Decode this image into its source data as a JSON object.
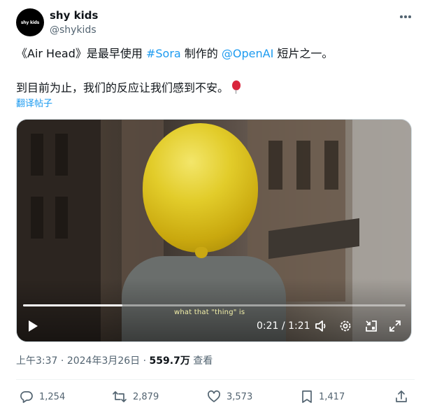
{
  "author": {
    "avatar_text": "shy kids",
    "display_name": "shy kids",
    "handle": "@shykids"
  },
  "tweet": {
    "line1_prefix": "《Air Head》是最早使用 ",
    "hashtag": "#Sora",
    "line1_mid": " 制作的 ",
    "mention": "@OpenAI",
    "line1_suffix": " 短片之一。",
    "line2": "到目前为止，我们的反应让我们感到不安。",
    "emoji": "balloon",
    "translate_label": "翻译帖子"
  },
  "video": {
    "subtitle": "what that \"thing\" is",
    "current_time": "0:21",
    "separator": " / ",
    "duration": "1:21",
    "progress_fraction": 0.26,
    "controls": [
      "play-icon",
      "volume-icon",
      "settings-icon",
      "picture-in-picture-icon",
      "fullscreen-icon"
    ]
  },
  "meta": {
    "time": "上午3:37",
    "dot": " · ",
    "date": "2024年3月26日",
    "views_count": "559.7万",
    "views_label": " 查看"
  },
  "actions": {
    "replies": "1,254",
    "reposts": "2,879",
    "likes": "3,573",
    "bookmarks": "1,417"
  },
  "colors": {
    "accent": "#1d9bf0",
    "text": "#0f1419",
    "muted": "#536471",
    "balloon": "#e2cc2a"
  }
}
